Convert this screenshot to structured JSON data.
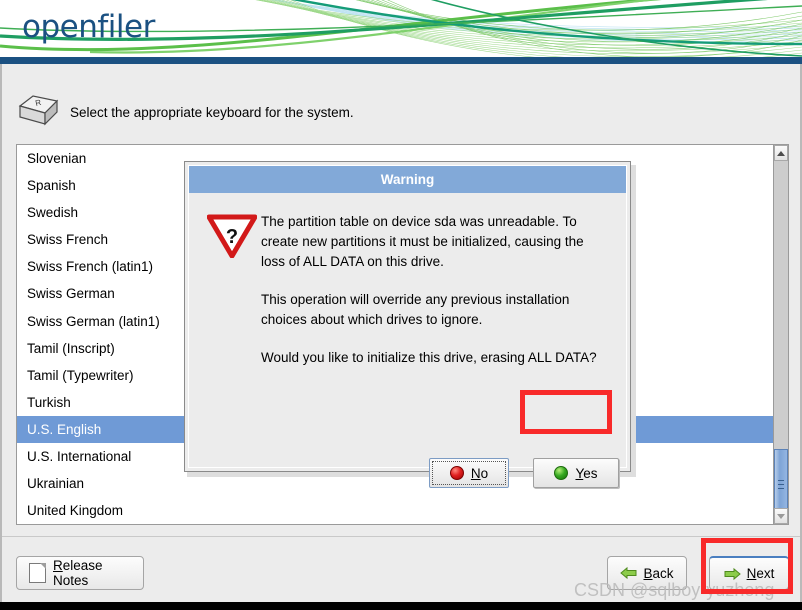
{
  "header": {
    "logo": "openfiler"
  },
  "instruction": {
    "icon": "keyboard-key-icon",
    "key_letter": "R",
    "text": "Select the appropriate keyboard for the system."
  },
  "keyboard_list": {
    "selected": "U.S. English",
    "items": [
      "Slovenian",
      "Spanish",
      "Swedish",
      "Swiss French",
      "Swiss French (latin1)",
      "Swiss German",
      "Swiss German (latin1)",
      "Tamil (Inscript)",
      "Tamil (Typewriter)",
      "Turkish",
      "U.S. English",
      "U.S. International",
      "Ukrainian",
      "United Kingdom"
    ]
  },
  "scrollbar": {
    "up_icon": "chevron-up-icon",
    "down_icon": "chevron-down-icon"
  },
  "dialog": {
    "title": "Warning",
    "icon": "warning-triangle-question-icon",
    "paragraphs": [
      "The partition table on device sda was unreadable. To create new partitions it must be initialized, causing the loss of ALL DATA on this drive.",
      "This operation will override any previous installation choices about which drives to ignore.",
      "Would you like to initialize this drive, erasing ALL DATA?"
    ],
    "buttons": {
      "no": {
        "mnemonic": "N",
        "rest": "o",
        "icon": "red-circle-icon"
      },
      "yes": {
        "mnemonic": "Y",
        "rest": "es",
        "icon": "green-circle-icon"
      }
    }
  },
  "footer": {
    "release_notes": {
      "mnemonic": "R",
      "rest": "elease Notes",
      "icon": "document-icon"
    },
    "back": {
      "mnemonic": "B",
      "rest": "ack",
      "icon": "arrow-left-icon"
    },
    "next": {
      "mnemonic": "N",
      "rest": "ext",
      "icon": "arrow-right-icon"
    }
  },
  "watermark": "CSDN @sqlboy-yuzheng",
  "colors": {
    "brand_blue": "#1b5182",
    "title_blue": "#82a9d8",
    "selection_blue": "#6f9ad6",
    "annotation_red": "#f82a2a",
    "page_bg": "#ececec"
  }
}
